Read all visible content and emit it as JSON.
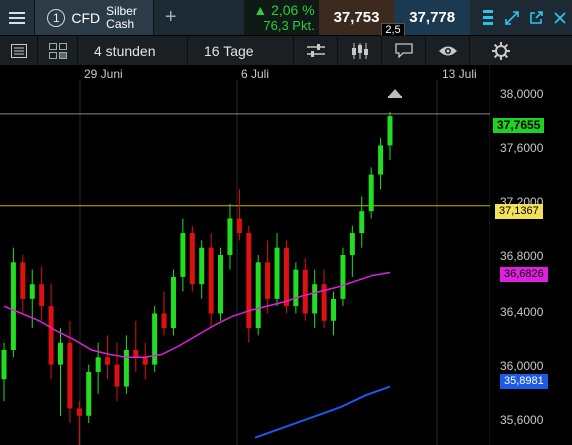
{
  "header": {
    "tab_number": "1",
    "tab_type": "CFD",
    "instrument_line1": "Silber",
    "instrument_line2": "Cash",
    "add_tab": "+",
    "change_pct": "▲ 2,06 %",
    "change_pts": "76,3 Pkt.",
    "bid": "37,753",
    "ask": "37,778",
    "spread": "2,5"
  },
  "toolbar": {
    "timeframe": "4 stunden",
    "range": "16 Tage"
  },
  "chart_data": {
    "type": "candlestick",
    "x_labels": [
      "29 Juni",
      "6 Juli",
      "13 Juli"
    ],
    "y_ticks": [
      "38,0000",
      "37,6000",
      "37,2000",
      "36,8000",
      "36,4000",
      "36,0000",
      "35,6000"
    ],
    "ylim": [
      35.5,
      38.1
    ],
    "price_tag": "37,7655",
    "level_tag": "37,1367",
    "ma1_tag": "36,6826",
    "ma2_tag": "35,8981",
    "colors": {
      "up": "#22dd22",
      "down": "#dd1111",
      "price_line": "#888888",
      "level_line": "#c8b400",
      "ma1": "#e020e0",
      "ma2": "#2255ee"
    },
    "candles": [
      [
        35.95,
        36.2,
        35.8,
        36.15
      ],
      [
        36.15,
        36.85,
        36.1,
        36.75
      ],
      [
        36.75,
        36.8,
        36.4,
        36.5
      ],
      [
        36.5,
        36.7,
        36.3,
        36.6
      ],
      [
        36.6,
        36.72,
        36.35,
        36.45
      ],
      [
        36.45,
        36.6,
        35.95,
        36.05
      ],
      [
        36.05,
        36.3,
        35.7,
        36.2
      ],
      [
        36.2,
        36.35,
        35.65,
        35.75
      ],
      [
        35.75,
        35.8,
        35.5,
        35.7
      ],
      [
        35.7,
        36.05,
        35.65,
        36.0
      ],
      [
        36.0,
        36.2,
        35.85,
        36.1
      ],
      [
        36.1,
        36.25,
        35.95,
        36.05
      ],
      [
        36.05,
        36.2,
        35.8,
        35.9
      ],
      [
        35.9,
        36.25,
        35.85,
        36.15
      ],
      [
        36.15,
        36.35,
        36.0,
        36.1
      ],
      [
        36.1,
        36.2,
        35.95,
        36.05
      ],
      [
        36.05,
        36.45,
        36.0,
        36.4
      ],
      [
        36.4,
        36.55,
        36.25,
        36.3
      ],
      [
        36.3,
        36.7,
        36.25,
        36.65
      ],
      [
        36.65,
        37.05,
        36.55,
        36.95
      ],
      [
        36.95,
        37.0,
        36.55,
        36.6
      ],
      [
        36.6,
        36.9,
        36.5,
        36.85
      ],
      [
        36.85,
        36.95,
        36.3,
        36.4
      ],
      [
        36.4,
        36.85,
        36.35,
        36.8
      ],
      [
        36.8,
        37.15,
        36.7,
        37.05
      ],
      [
        37.05,
        37.25,
        36.9,
        36.95
      ],
      [
        36.95,
        37.0,
        36.2,
        36.3
      ],
      [
        36.3,
        36.8,
        36.25,
        36.75
      ],
      [
        36.75,
        36.9,
        36.4,
        36.5
      ],
      [
        36.5,
        36.95,
        36.45,
        36.85
      ],
      [
        36.85,
        36.9,
        36.4,
        36.45
      ],
      [
        36.45,
        36.75,
        36.4,
        36.7
      ],
      [
        36.7,
        36.78,
        36.35,
        36.4
      ],
      [
        36.4,
        36.7,
        36.3,
        36.6
      ],
      [
        36.6,
        36.7,
        36.3,
        36.35
      ],
      [
        36.35,
        36.55,
        36.25,
        36.5
      ],
      [
        36.5,
        36.85,
        36.45,
        36.8
      ],
      [
        36.8,
        37.0,
        36.65,
        36.95
      ],
      [
        36.95,
        37.2,
        36.85,
        37.1
      ],
      [
        37.1,
        37.4,
        37.05,
        37.35
      ],
      [
        37.35,
        37.6,
        37.25,
        37.55
      ],
      [
        37.55,
        37.78,
        37.45,
        37.75
      ]
    ],
    "ma1": [
      36.45,
      36.4,
      36.35,
      36.28,
      36.22,
      36.15,
      36.12,
      36.1,
      36.1,
      36.12,
      36.18,
      36.25,
      36.32,
      36.38,
      36.42,
      36.45,
      36.48,
      36.52,
      36.55,
      36.58,
      36.62,
      36.66,
      36.68
    ],
    "ma2": [
      35.55,
      35.58,
      35.61,
      35.64,
      35.67,
      35.7,
      35.73,
      35.76,
      35.8,
      35.84,
      35.87,
      35.9
    ]
  }
}
